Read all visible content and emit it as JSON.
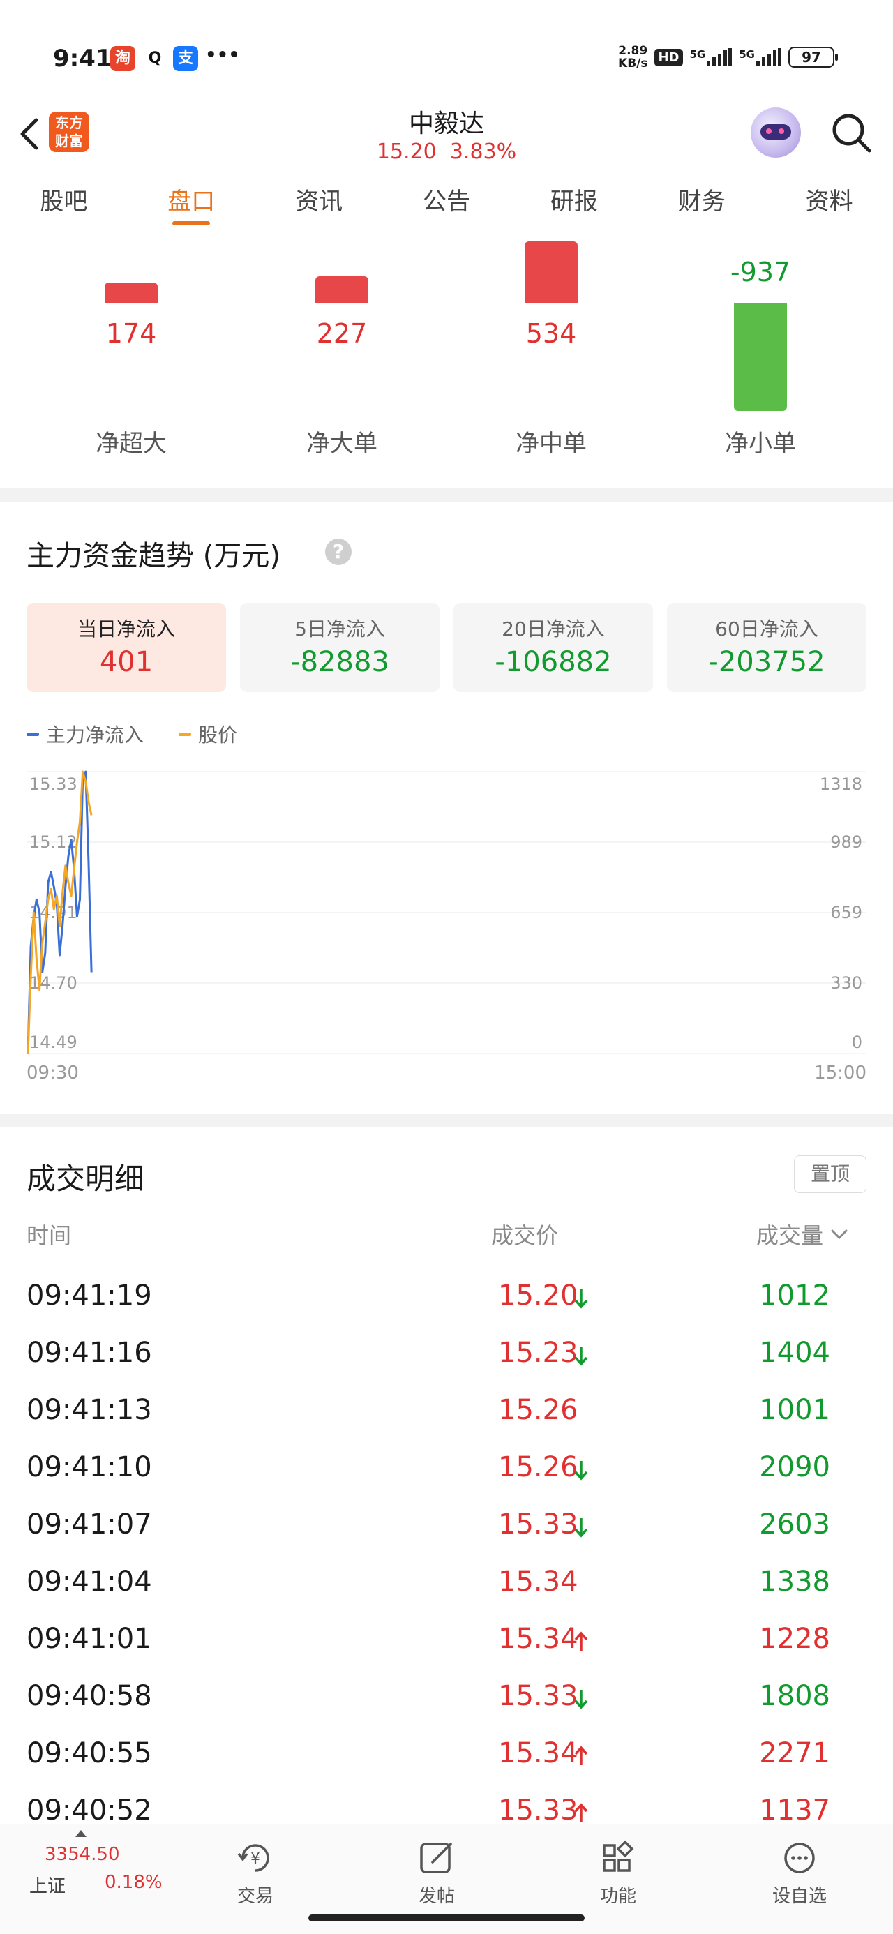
{
  "status_bar": {
    "time": "9:41",
    "app_icons": [
      "淘",
      "Q",
      "支"
    ],
    "more": "•••",
    "net_speed_top": "2.89",
    "net_speed_bottom": "KB/s",
    "hd": "HD",
    "sig1": "5G",
    "sig2": "5G",
    "battery": "97"
  },
  "header": {
    "logo_text": "东方财富",
    "stock_name": "中毅达",
    "price": "15.20",
    "change_pct": "3.83%"
  },
  "tabs": [
    {
      "label": "股吧",
      "active": false
    },
    {
      "label": "盘口",
      "active": true
    },
    {
      "label": "资讯",
      "active": false
    },
    {
      "label": "公告",
      "active": false
    },
    {
      "label": "研报",
      "active": false
    },
    {
      "label": "财务",
      "active": false
    },
    {
      "label": "资料",
      "active": false
    }
  ],
  "net_flow": {
    "items": [
      {
        "label": "净超大",
        "value": 174
      },
      {
        "label": "净大单",
        "value": 227
      },
      {
        "label": "净中单",
        "value": 534
      },
      {
        "label": "净小单",
        "value": -937
      }
    ],
    "colors": {
      "positive": "#e8474a",
      "negative": "#5bbd47"
    }
  },
  "trend": {
    "title": "主力资金趋势 (万元)",
    "help": "?",
    "cards": [
      {
        "label": "当日净流入",
        "value": "401",
        "active": true,
        "sign": "pos"
      },
      {
        "label": "5日净流入",
        "value": "-82883",
        "active": false,
        "sign": "neg"
      },
      {
        "label": "20日净流入",
        "value": "-106882",
        "active": false,
        "sign": "neg"
      },
      {
        "label": "60日净流入",
        "value": "-203752",
        "active": false,
        "sign": "neg"
      }
    ],
    "legend": [
      {
        "name": "主力净流入",
        "color": "#3a6fd8"
      },
      {
        "name": "股价",
        "color": "#f5a623"
      }
    ]
  },
  "chart_data": {
    "type": "line",
    "left_axis": {
      "ticks": [
        "15.33",
        "15.12",
        "14.91",
        "14.70",
        "14.49"
      ],
      "range": [
        14.49,
        15.33
      ]
    },
    "right_axis": {
      "ticks": [
        "1318",
        "989",
        "659",
        "330",
        "0"
      ],
      "range": [
        0,
        1318
      ]
    },
    "x_ticks": [
      "09:30",
      "15:00"
    ],
    "total_minutes": 240,
    "series": [
      {
        "name": "主力净流入",
        "color": "#3a6fd8",
        "axis": "right",
        "points": [
          [
            0,
            0
          ],
          [
            0.5,
            500
          ],
          [
            1,
            640
          ],
          [
            1.5,
            720
          ],
          [
            2,
            660
          ],
          [
            2.5,
            380
          ],
          [
            3,
            470
          ],
          [
            3.5,
            800
          ],
          [
            4,
            850
          ],
          [
            4.5,
            780
          ],
          [
            5,
            700
          ],
          [
            5.5,
            460
          ],
          [
            6,
            600
          ],
          [
            6.5,
            780
          ],
          [
            7,
            920
          ],
          [
            7.5,
            1000
          ],
          [
            8,
            860
          ],
          [
            8.5,
            640
          ],
          [
            9,
            720
          ],
          [
            9.5,
            1280
          ],
          [
            10,
            1318
          ],
          [
            10.5,
            900
          ],
          [
            11,
            380
          ]
        ]
      },
      {
        "name": "股价",
        "color": "#f5a623",
        "axis": "left",
        "points": [
          [
            0,
            14.49
          ],
          [
            0.5,
            14.72
          ],
          [
            1,
            14.91
          ],
          [
            1.5,
            14.77
          ],
          [
            2,
            14.68
          ],
          [
            2.5,
            14.82
          ],
          [
            3,
            14.88
          ],
          [
            3.5,
            14.95
          ],
          [
            4,
            14.98
          ],
          [
            4.5,
            14.92
          ],
          [
            5,
            14.96
          ],
          [
            5.5,
            14.87
          ],
          [
            6,
            14.97
          ],
          [
            6.5,
            15.05
          ],
          [
            7,
            15.0
          ],
          [
            7.5,
            14.96
          ],
          [
            8,
            15.04
          ],
          [
            8.5,
            15.12
          ],
          [
            9,
            15.18
          ],
          [
            9.5,
            15.33
          ],
          [
            10,
            15.3
          ],
          [
            10.5,
            15.24
          ],
          [
            11,
            15.2
          ]
        ]
      }
    ]
  },
  "transactions": {
    "title": "成交明细",
    "pin_label": "置顶",
    "headers": {
      "time": "时间",
      "price": "成交价",
      "volume": "成交量"
    },
    "rows": [
      {
        "time": "09:41:19",
        "price": "15.20",
        "dir": "down",
        "volume": "1012",
        "vol_color": "green"
      },
      {
        "time": "09:41:16",
        "price": "15.23",
        "dir": "down",
        "volume": "1404",
        "vol_color": "green"
      },
      {
        "time": "09:41:13",
        "price": "15.26",
        "dir": "none",
        "volume": "1001",
        "vol_color": "green"
      },
      {
        "time": "09:41:10",
        "price": "15.26",
        "dir": "down",
        "volume": "2090",
        "vol_color": "green"
      },
      {
        "time": "09:41:07",
        "price": "15.33",
        "dir": "down",
        "volume": "2603",
        "vol_color": "green"
      },
      {
        "time": "09:41:04",
        "price": "15.34",
        "dir": "none",
        "volume": "1338",
        "vol_color": "green"
      },
      {
        "time": "09:41:01",
        "price": "15.34",
        "dir": "up",
        "volume": "1228",
        "vol_color": "red"
      },
      {
        "time": "09:40:58",
        "price": "15.33",
        "dir": "down",
        "volume": "1808",
        "vol_color": "green"
      },
      {
        "time": "09:40:55",
        "price": "15.34",
        "dir": "up",
        "volume": "2271",
        "vol_color": "red"
      },
      {
        "time": "09:40:52",
        "price": "15.33",
        "dir": "up",
        "volume": "1137",
        "vol_color": "red"
      }
    ]
  },
  "bottom_nav": {
    "index_price": "3354.50",
    "index_name": "上证",
    "index_pct": "0.18%",
    "items": [
      {
        "label": "交易",
        "icon": "yen-trade-icon"
      },
      {
        "label": "发帖",
        "icon": "edit-icon"
      },
      {
        "label": "功能",
        "icon": "grid-icon"
      },
      {
        "label": "设自选",
        "icon": "more-circle-icon"
      }
    ]
  }
}
